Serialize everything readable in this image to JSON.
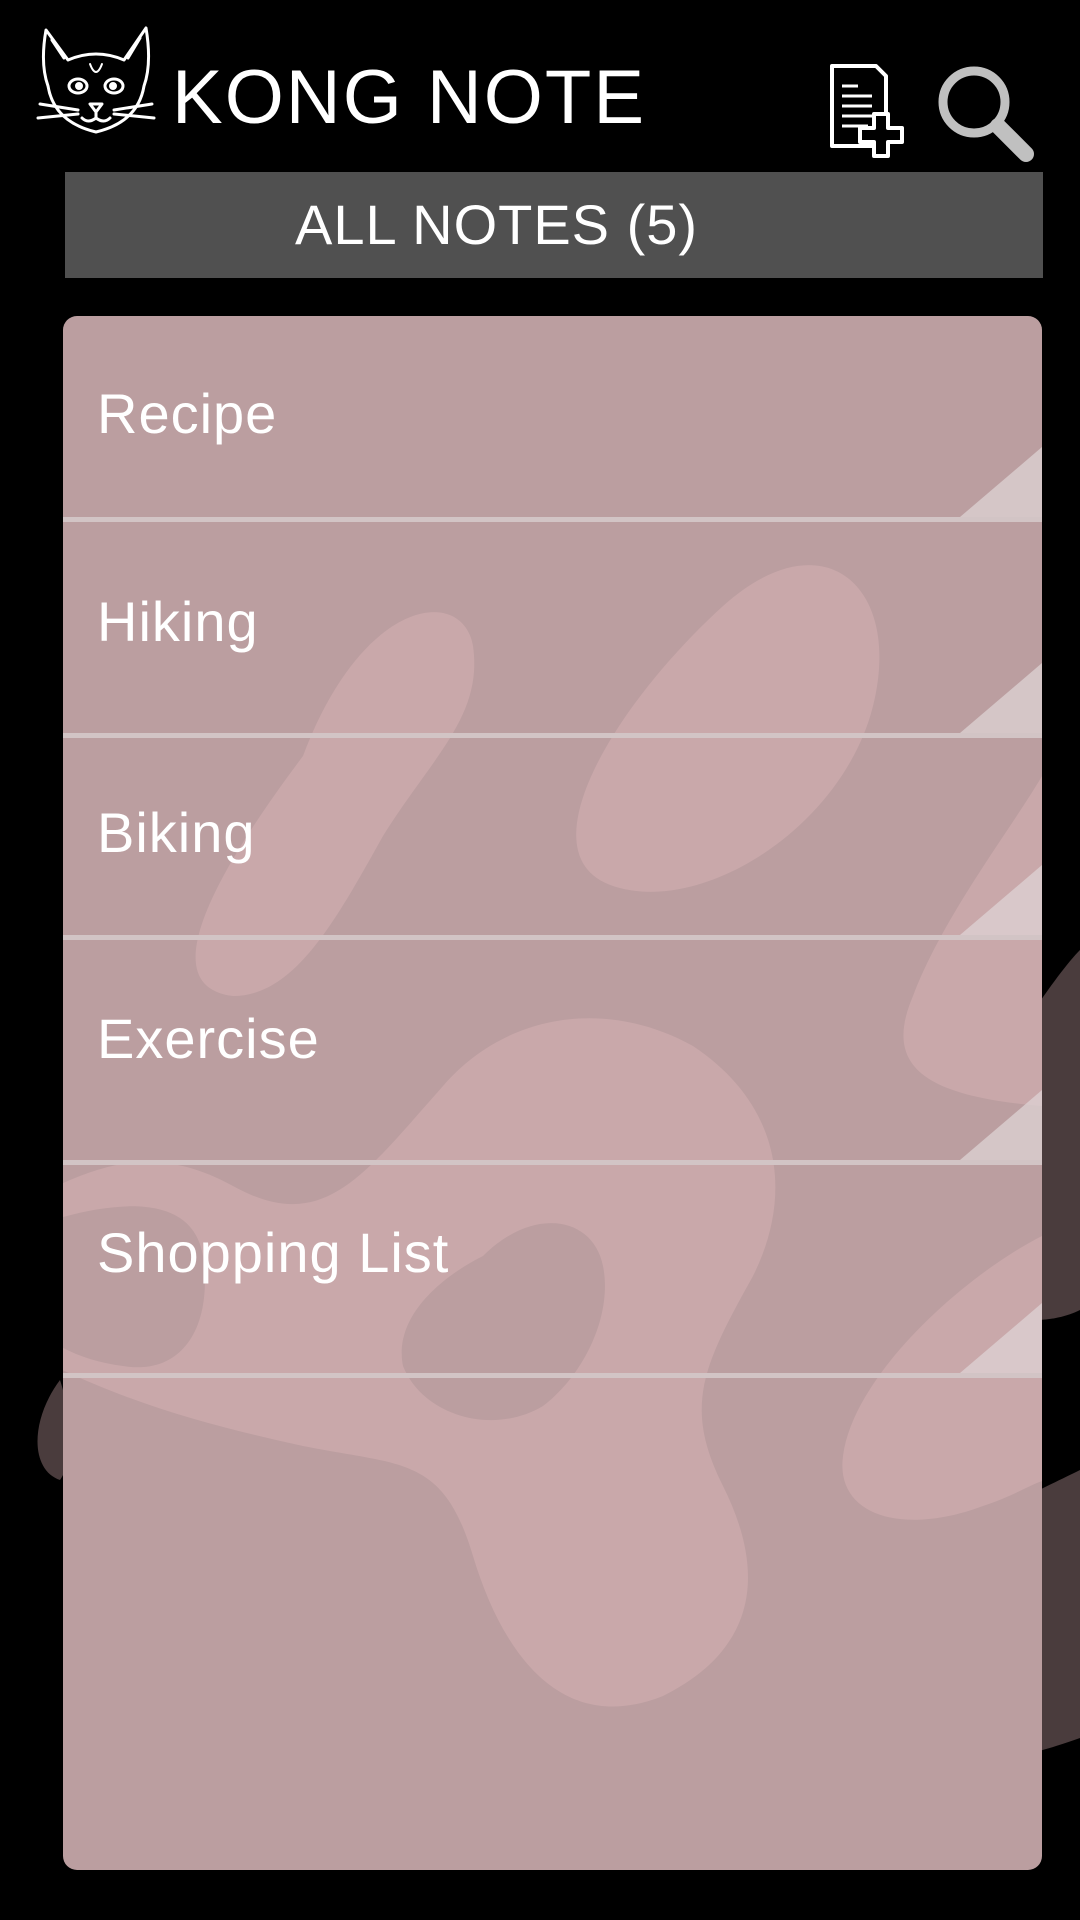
{
  "app": {
    "title": "KONG NOTE",
    "logo_icon": "cat-face-icon"
  },
  "toolbar": {
    "new_note_icon": "new-note-icon",
    "search_icon": "search-icon"
  },
  "filter": {
    "label": "ALL NOTES (5)"
  },
  "notes": [
    {
      "title": "Recipe"
    },
    {
      "title": "Hiking"
    },
    {
      "title": "Biking"
    },
    {
      "title": "Exercise"
    },
    {
      "title": "Shopping List"
    }
  ],
  "colors": {
    "background": "#000000",
    "filter_bar": "#505050",
    "panel": "#bb9ea0",
    "paw_light": "#c9a8aa",
    "paw_dark": "#4a3c3d",
    "divider": "#d2c4c5",
    "text": "#ffffff"
  }
}
